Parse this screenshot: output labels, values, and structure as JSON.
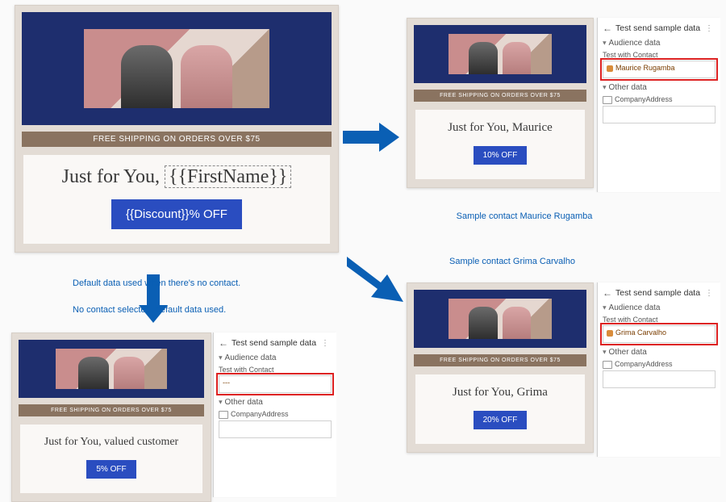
{
  "common": {
    "ship_bar": "FREE SHIPPING ON ORDERS OVER $75",
    "headline_prefix": "Just for You, "
  },
  "template": {
    "name_token": "{{FirstName}}",
    "cta": "{{Discount}}% OFF"
  },
  "default_preview": {
    "name": "valued customer",
    "cta": "5% OFF"
  },
  "maurice": {
    "name": "Maurice",
    "cta": "10% OFF",
    "contact_pill": "Maurice Rugamba"
  },
  "grima": {
    "name": "Grima",
    "cta": "20% OFF",
    "contact_pill": "Grima Carvalho"
  },
  "panel": {
    "title": "Test send sample data",
    "audience": "Audience data",
    "test_contact": "Test with Contact",
    "empty_contact": "---",
    "other": "Other data",
    "company": "CompanyAddress"
  },
  "captions": {
    "default_1": "Default data used when there's no contact.",
    "default_2": "No contact selected, default data used.",
    "maurice": "Sample contact Maurice Rugamba",
    "grima": "Sample contact Grima Carvalho"
  }
}
